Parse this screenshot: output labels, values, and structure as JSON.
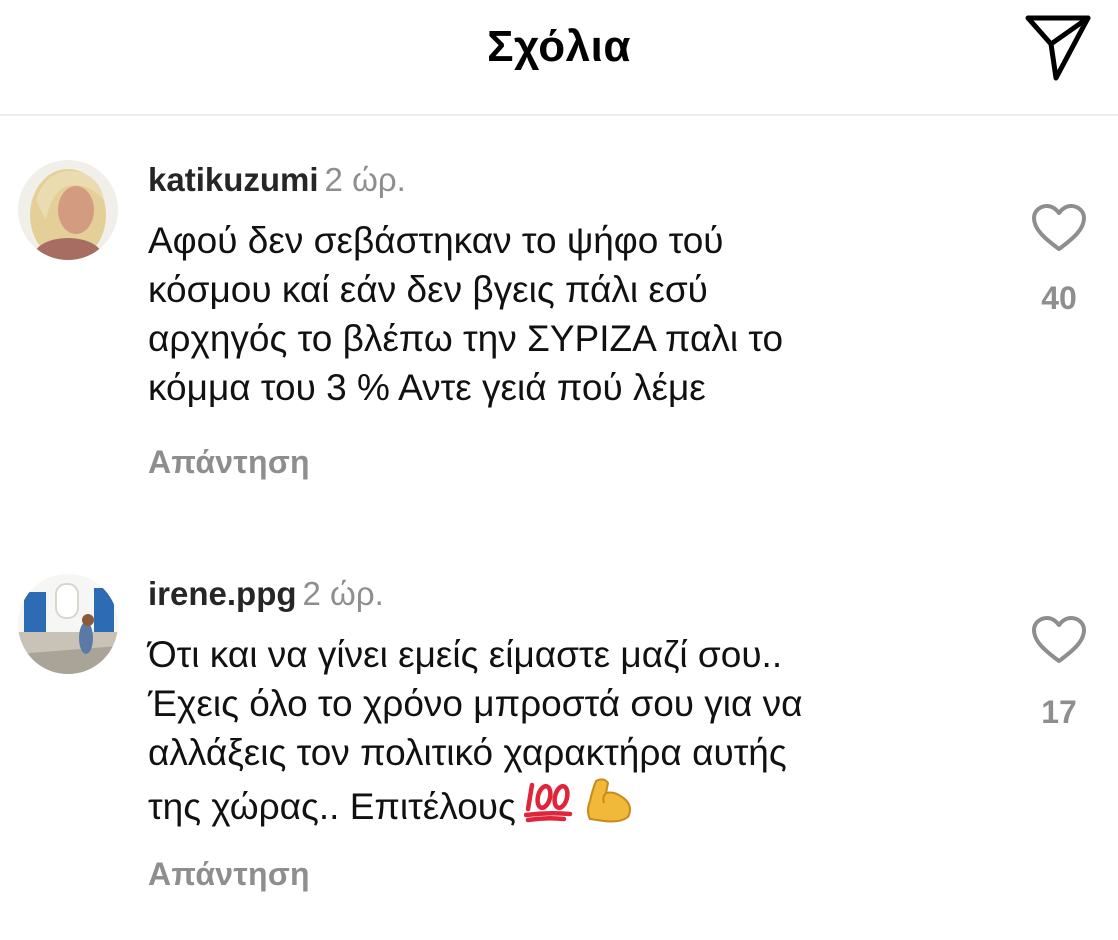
{
  "header": {
    "title": "Σχόλια",
    "share_icon": "paper-plane-icon"
  },
  "comments": [
    {
      "username": "katikuzumi",
      "time": "2 ώρ.",
      "lines": [
        "Αφού δεν σεβάστηκαν το ψήφο τού",
        "κόσμου καί εάν δεν βγεις πάλι εσύ",
        "αρχηγός το βλέπω την ΣΥΡΙΖΑ παλι το",
        "κόμμα του 3 % Αντε γειά πού λέμε"
      ],
      "reply_label": "Απάντηση",
      "like_count": "40",
      "like_icon": "heart-outline-icon",
      "avatar_colors": [
        "#b7a98f",
        "#e8d6a8",
        "#c98a73"
      ]
    },
    {
      "username": "irene.ppg",
      "time": "2 ώρ.",
      "lines": [
        "Ότι και να γίνει εμείς είμαστε μαζί σου..",
        "Έχεις όλο το χρόνο μπροστά σου για να",
        "αλλάξεις τον πολιτικό χαρακτήρα αυτής",
        "της χώρας.. Επιτέλους"
      ],
      "emojis": [
        "hundred-points-emoji",
        "flexed-biceps-emoji"
      ],
      "reply_label": "Απάντηση",
      "like_count": "17",
      "like_icon": "heart-outline-icon",
      "avatar_colors": [
        "#e9eef5",
        "#2f6fb6",
        "#cbbf9c"
      ]
    }
  ]
}
